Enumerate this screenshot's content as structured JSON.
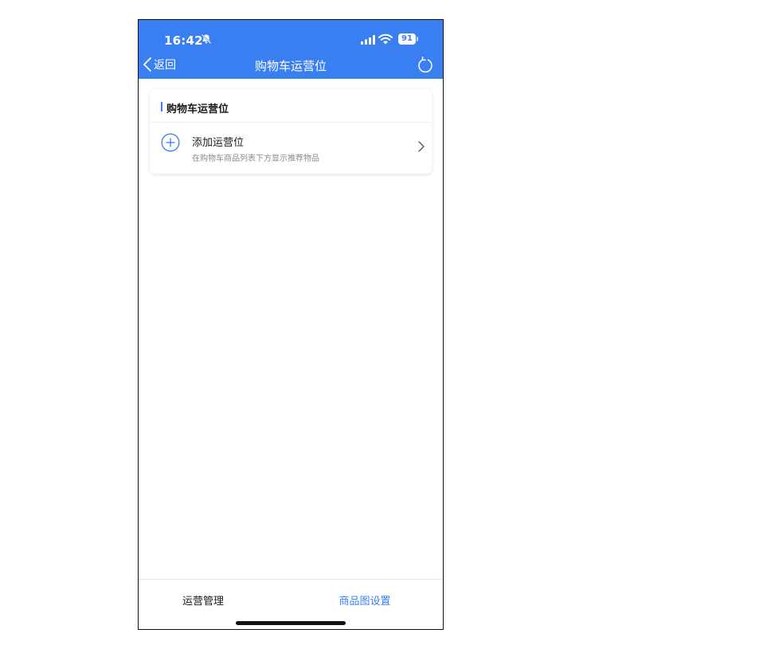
{
  "status_bar": {
    "time": "16:42",
    "battery_level": "91",
    "icons": [
      "bell-slash-icon",
      "signal-icon",
      "wifi-icon",
      "battery-icon"
    ]
  },
  "nav": {
    "back_label": "返回",
    "title": "购物车运营位",
    "refresh_icon": "refresh-icon"
  },
  "card": {
    "title": "购物车运营位",
    "row": {
      "title": "添加运营位",
      "subtitle": "在购物车商品列表下方显示推荐物品",
      "leading_icon": "plus-circle-icon",
      "trailing_icon": "chevron-right-icon"
    }
  },
  "tabs": [
    {
      "label": "运营管理",
      "active": false
    },
    {
      "label": "商品图设置",
      "active": true
    }
  ],
  "colors": {
    "accent": "#3a7ff2",
    "text_primary": "#1a1a1a",
    "text_secondary": "#8a8a8a"
  }
}
